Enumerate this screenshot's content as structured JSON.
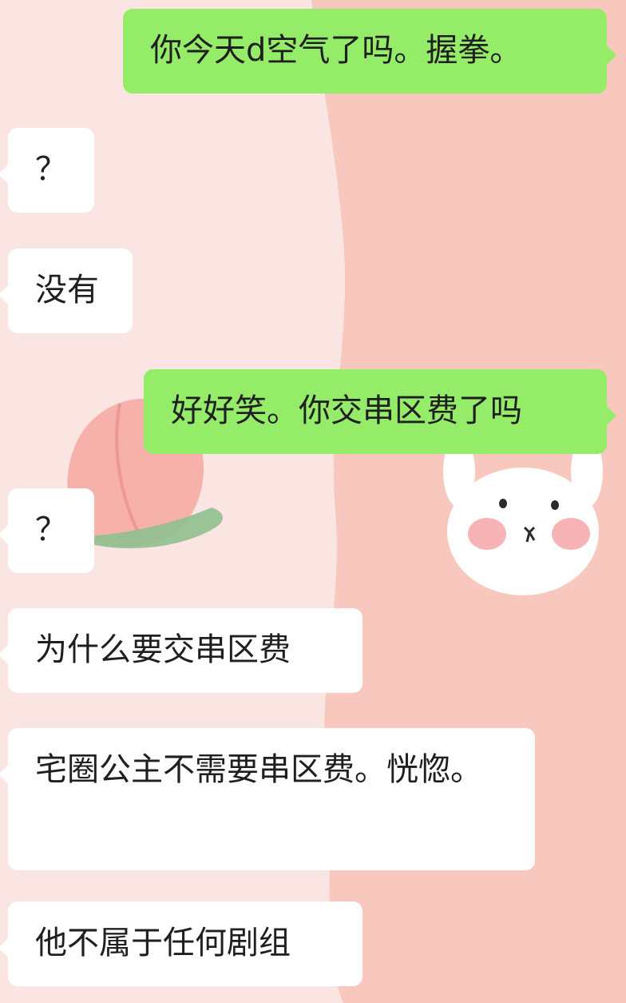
{
  "chat": {
    "messages": [
      {
        "side": "out",
        "text": "你今天d空气了吗。握拳。"
      },
      {
        "side": "in",
        "text": "？"
      },
      {
        "side": "in",
        "text": "没有"
      },
      {
        "side": "out",
        "text": "好好笑。你交串区费了吗"
      },
      {
        "side": "in",
        "text": "？"
      },
      {
        "side": "in",
        "text": "为什么要交串区费"
      },
      {
        "side": "in",
        "text": "宅圈公主不需要串区费。恍惚。"
      },
      {
        "side": "in",
        "text": "他不属于任何剧组"
      }
    ]
  },
  "colors": {
    "outgoing_bubble": "#95ec69",
    "incoming_bubble": "#ffffff",
    "background": "#fbe5e3"
  }
}
